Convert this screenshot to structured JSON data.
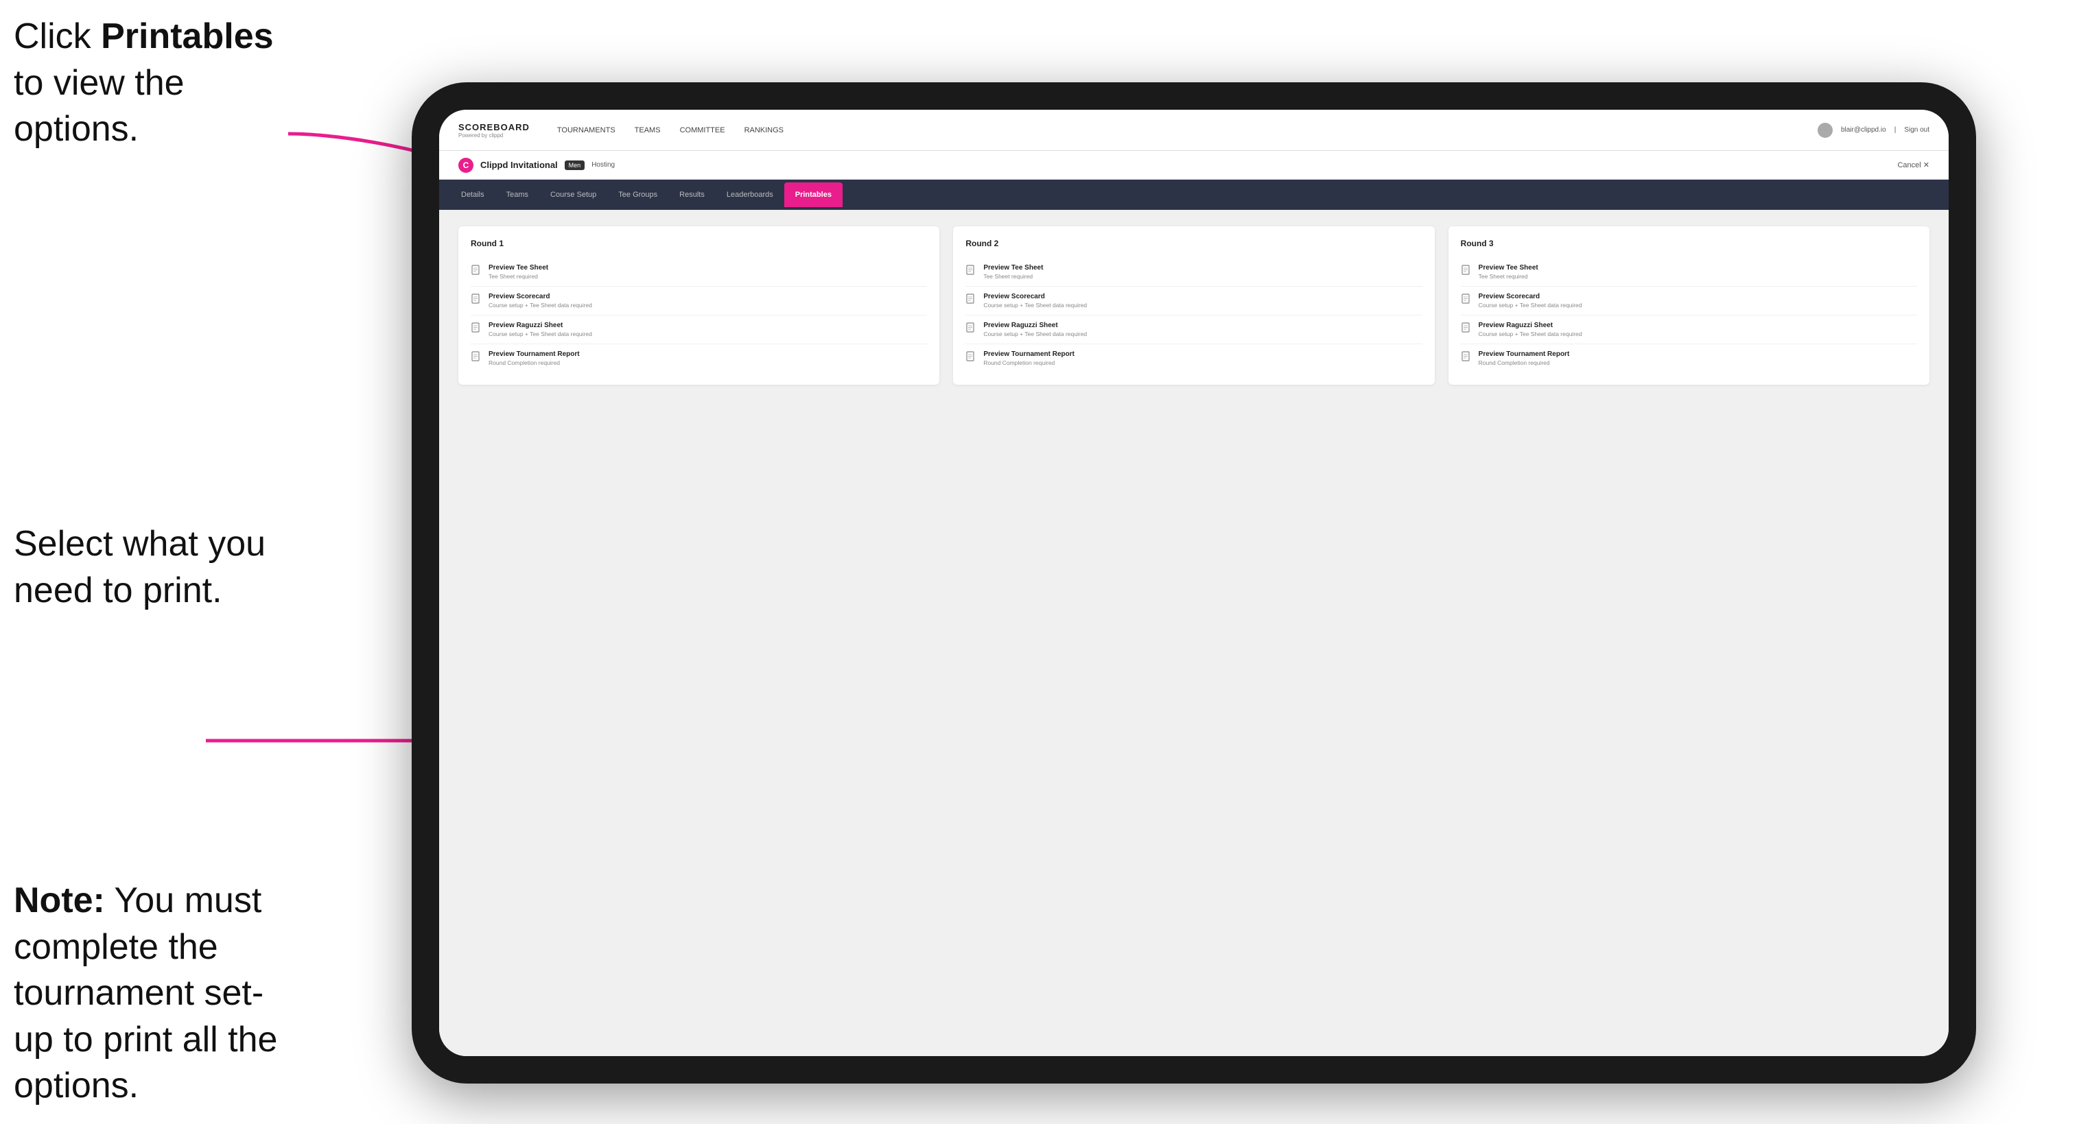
{
  "annotations": {
    "top_text_1": "Click ",
    "top_text_bold": "Printables",
    "top_text_2": " to view the options.",
    "middle_text": "Select what you need to print.",
    "bottom_note_bold": "Note:",
    "bottom_note_text": " You must complete the tournament set-up to print all the options."
  },
  "nav": {
    "logo_title": "SCOREBOARD",
    "logo_sub": "Powered by clippd",
    "links": [
      {
        "label": "TOURNAMENTS",
        "active": false
      },
      {
        "label": "TEAMS",
        "active": false
      },
      {
        "label": "COMMITTEE",
        "active": false
      },
      {
        "label": "RANKINGS",
        "active": false
      }
    ],
    "user_email": "blair@clippd.io",
    "sign_out": "Sign out"
  },
  "tournament_bar": {
    "name": "Clippd Invitational",
    "badge": "Men",
    "hosting": "Hosting",
    "cancel": "Cancel ✕"
  },
  "sub_nav": {
    "items": [
      {
        "label": "Details",
        "active": false
      },
      {
        "label": "Teams",
        "active": false
      },
      {
        "label": "Course Setup",
        "active": false
      },
      {
        "label": "Tee Groups",
        "active": false
      },
      {
        "label": "Results",
        "active": false
      },
      {
        "label": "Leaderboards",
        "active": false
      },
      {
        "label": "Printables",
        "active": true
      }
    ]
  },
  "rounds": [
    {
      "title": "Round 1",
      "items": [
        {
          "title": "Preview Tee Sheet",
          "sub": "Tee Sheet required"
        },
        {
          "title": "Preview Scorecard",
          "sub": "Course setup + Tee Sheet data required"
        },
        {
          "title": "Preview Raguzzi Sheet",
          "sub": "Course setup + Tee Sheet data required"
        },
        {
          "title": "Preview Tournament Report",
          "sub": "Round Completion required"
        }
      ]
    },
    {
      "title": "Round 2",
      "items": [
        {
          "title": "Preview Tee Sheet",
          "sub": "Tee Sheet required"
        },
        {
          "title": "Preview Scorecard",
          "sub": "Course setup + Tee Sheet data required"
        },
        {
          "title": "Preview Raguzzi Sheet",
          "sub": "Course setup + Tee Sheet data required"
        },
        {
          "title": "Preview Tournament Report",
          "sub": "Round Completion required"
        }
      ]
    },
    {
      "title": "Round 3",
      "items": [
        {
          "title": "Preview Tee Sheet",
          "sub": "Tee Sheet required"
        },
        {
          "title": "Preview Scorecard",
          "sub": "Course setup + Tee Sheet data required"
        },
        {
          "title": "Preview Raguzzi Sheet",
          "sub": "Course setup + Tee Sheet data required"
        },
        {
          "title": "Preview Tournament Report",
          "sub": "Round Completion required"
        }
      ]
    }
  ]
}
